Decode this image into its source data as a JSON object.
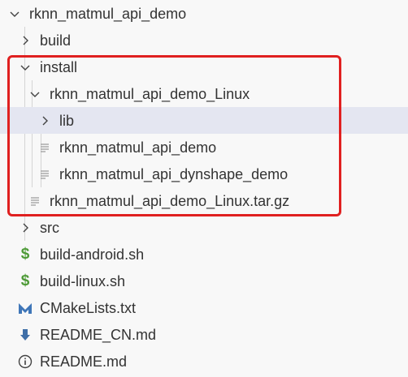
{
  "explorer": {
    "root": {
      "label": "rknn_matmul_api_demo",
      "icon": "chevron-down-icon",
      "expanded": true
    },
    "items": {
      "build": {
        "label": "build",
        "icon": "chevron-right-icon",
        "expanded": false
      },
      "install": {
        "label": "install",
        "icon": "chevron-down-icon",
        "expanded": true
      },
      "linux_folder": {
        "label": "rknn_matmul_api_demo_Linux",
        "icon": "chevron-down-icon",
        "expanded": true
      },
      "lib": {
        "label": "lib",
        "icon": "chevron-right-icon",
        "expanded": false,
        "selected": true
      },
      "demo_bin": {
        "label": "rknn_matmul_api_demo",
        "icon": "file-lines-icon"
      },
      "dynshape_bin": {
        "label": "rknn_matmul_api_dynshape_demo",
        "icon": "file-lines-icon"
      },
      "tarball": {
        "label": "rknn_matmul_api_demo_Linux.tar.gz",
        "icon": "file-lines-icon"
      },
      "src": {
        "label": "src",
        "icon": "chevron-right-icon",
        "expanded": false
      },
      "build_android": {
        "label": "build-android.sh",
        "icon": "dollar-icon"
      },
      "build_linux": {
        "label": "build-linux.sh",
        "icon": "dollar-icon"
      },
      "cmakelists": {
        "label": "CMakeLists.txt",
        "icon": "cmake-m-icon"
      },
      "readme_cn": {
        "label": "README_CN.md",
        "icon": "arrow-down-icon"
      },
      "readme": {
        "label": "README.md",
        "icon": "info-icon"
      }
    }
  },
  "colors": {
    "background": "#f8f8f8",
    "selected_row": "#e4e6f1",
    "highlight_box": "#e02020",
    "shell_icon": "#4d9a36",
    "cmake_icon": "#3f76b8",
    "markdown_icon": "#3f6fa8",
    "text": "#333333",
    "chevron": "#424242",
    "file_icon": "#9a9a9a"
  }
}
